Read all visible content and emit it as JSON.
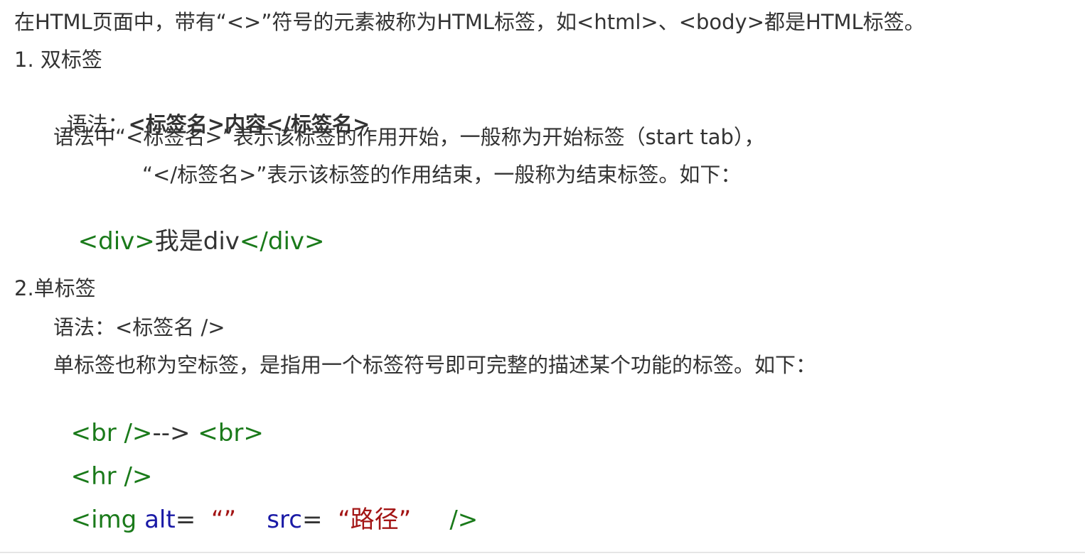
{
  "intro": "在HTML页面中，带有“<>”符号的元素被称为HTML标签，如<html>、<body>都是HTML标签。",
  "section1": {
    "heading": "1. 双标签",
    "syntax_label": "语法：",
    "syntax_value": "<标签名>内容</标签名>",
    "desc_line1": "语法中“<标签名>”表示该标签的作用开始，一般称为开始标签（start tab），",
    "desc_line2": "“</标签名>”表示该标签的作用结束，一般称为结束标签。如下：",
    "example": {
      "open_tag": "<div>",
      "text_cn": "我是",
      "text_en": "div",
      "close_tag": "</div>"
    }
  },
  "section2": {
    "heading": "2.单标签",
    "syntax": "语法：<标签名 />",
    "desc": "单标签也称为空标签，是指用一个标签符号即可完整的描述某个功能的标签。如下：",
    "examples": {
      "br_self": "<br />",
      "arrow": "-->",
      "br": "<br>",
      "hr": "<hr />",
      "img_open": "<img",
      "img_alt": "alt",
      "img_eq1": "=",
      "img_alt_val": "“”",
      "img_src": "src",
      "img_eq2": "=",
      "img_src_val": "“路径”",
      "img_close": "/>"
    }
  },
  "colors": {
    "text": "#333333",
    "tag": "#1a7a1a",
    "attr": "#1a1aa6",
    "value": "#a31515"
  }
}
